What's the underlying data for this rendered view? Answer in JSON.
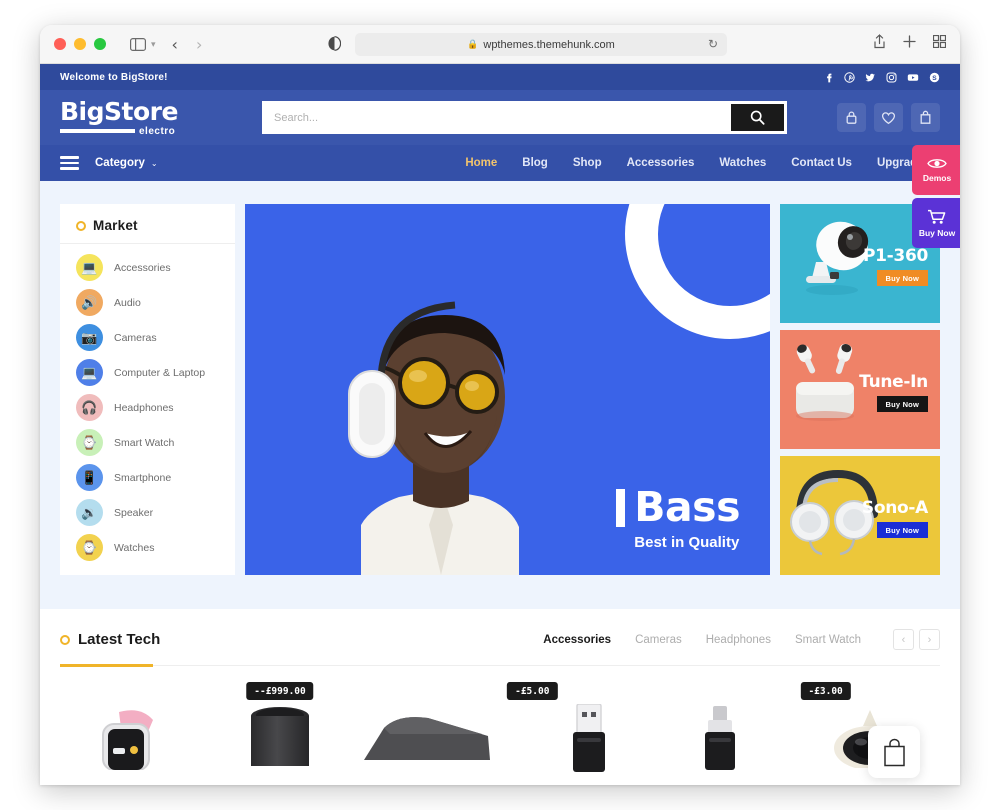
{
  "browser": {
    "url": "wpthemes.themehunk.com",
    "lock_icon": "lock-icon",
    "reload_icon": "reload-icon",
    "back_arrow": "‹",
    "forward_arrow": "›",
    "sidebar_icon": "sidebar-icon",
    "shield_icon": "shield-icon",
    "share_icon": "share-icon",
    "new_tab_icon": "plus-icon",
    "tab_overview_icon": "grid-icon"
  },
  "topbar": {
    "welcome": "Welcome to BigStore!",
    "socials": [
      {
        "name": "facebook",
        "glyph": "f"
      },
      {
        "name": "pinterest",
        "glyph": "Ⓟ"
      },
      {
        "name": "twitter",
        "glyph": "ᴠ"
      },
      {
        "name": "instagram",
        "glyph": "▣"
      },
      {
        "name": "youtube",
        "glyph": "▶"
      },
      {
        "name": "skype",
        "glyph": "S"
      }
    ]
  },
  "header": {
    "logo_main": "BigStore",
    "logo_sub": "electro",
    "search_placeholder": "Search...",
    "search_value": "",
    "search_button_icon": "search-icon",
    "icons": [
      {
        "name": "account-lock-icon",
        "glyph": "🔒"
      },
      {
        "name": "wishlist-heart-icon",
        "glyph": "♡"
      },
      {
        "name": "cart-bag-icon",
        "glyph": "👜"
      }
    ]
  },
  "nav": {
    "category_label": "Category",
    "category_caret": "⌄",
    "items": [
      {
        "label": "Home",
        "active": true
      },
      {
        "label": "Blog",
        "active": false
      },
      {
        "label": "Shop",
        "active": false
      },
      {
        "label": "Accessories",
        "active": false
      },
      {
        "label": "Watches",
        "active": false
      },
      {
        "label": "Contact Us",
        "active": false
      },
      {
        "label": "Upgrade To",
        "active": false
      }
    ]
  },
  "float_buttons": [
    {
      "label": "Demos",
      "color": "#ec3f72",
      "icon": "eye-icon"
    },
    {
      "label": "Buy Now",
      "color": "#5b32d6",
      "icon": "cart-icon"
    }
  ],
  "market": {
    "title": "Market",
    "items": [
      {
        "label": "Accessories",
        "bg": "#f5e45c",
        "glyph": "🖥"
      },
      {
        "label": "Audio",
        "bg": "#f0a961",
        "glyph": "🔊"
      },
      {
        "label": "Cameras",
        "bg": "#3e8fe0",
        "glyph": "📷"
      },
      {
        "label": "Computer & Laptop",
        "bg": "#4f7fe8",
        "glyph": "💻"
      },
      {
        "label": "Headphones",
        "bg": "#f0bcbc",
        "glyph": "🎧"
      },
      {
        "label": "Smart Watch",
        "bg": "#c8f0b8",
        "glyph": "⌚"
      },
      {
        "label": "Smartphone",
        "bg": "#5b94ec",
        "glyph": "📱"
      },
      {
        "label": "Speaker",
        "bg": "#b4ddee",
        "glyph": "🔉"
      },
      {
        "label": "Watches",
        "bg": "#f2d24f",
        "glyph": "⌚"
      }
    ]
  },
  "hero": {
    "title": "Bass",
    "subtitle": "Best in Quality",
    "bg_color": "#3a63e8",
    "image_alt": "man-with-headphones"
  },
  "promos": [
    {
      "name": "P1-360",
      "buy_label": "Buy Now",
      "bg": "#3ab5d0",
      "buy_bg": "#f08c24",
      "image_alt": "security-camera"
    },
    {
      "name": "Tune-In",
      "buy_label": "Buy Now",
      "bg": "#ef8268",
      "buy_bg": "#151515",
      "image_alt": "wireless-earbuds"
    },
    {
      "name": "Sono-A",
      "buy_label": "Buy Now",
      "bg": "#ecc73a",
      "buy_bg": "#1a2ed6",
      "image_alt": "over-ear-headphones"
    }
  ],
  "latest": {
    "title": "Latest Tech",
    "tabs": [
      {
        "label": "Accessories",
        "active": true
      },
      {
        "label": "Cameras",
        "active": false
      },
      {
        "label": "Headphones",
        "active": false
      },
      {
        "label": "Smart Watch",
        "active": false
      }
    ],
    "prev_arrow": "‹",
    "next_arrow": "›",
    "products": [
      {
        "badge": "",
        "image_alt": "pink-smartwatch"
      },
      {
        "badge": "--£999.00",
        "image_alt": "black-smart-speaker"
      },
      {
        "badge": "",
        "image_alt": "grey-device"
      },
      {
        "badge": "-£5.00",
        "image_alt": "usb-flash-drive"
      },
      {
        "badge": "",
        "image_alt": "usb-cable-connector"
      },
      {
        "badge": "-£3.00",
        "image_alt": "white-camera"
      }
    ],
    "cart_fab_icon": "shopping-bag-icon"
  }
}
